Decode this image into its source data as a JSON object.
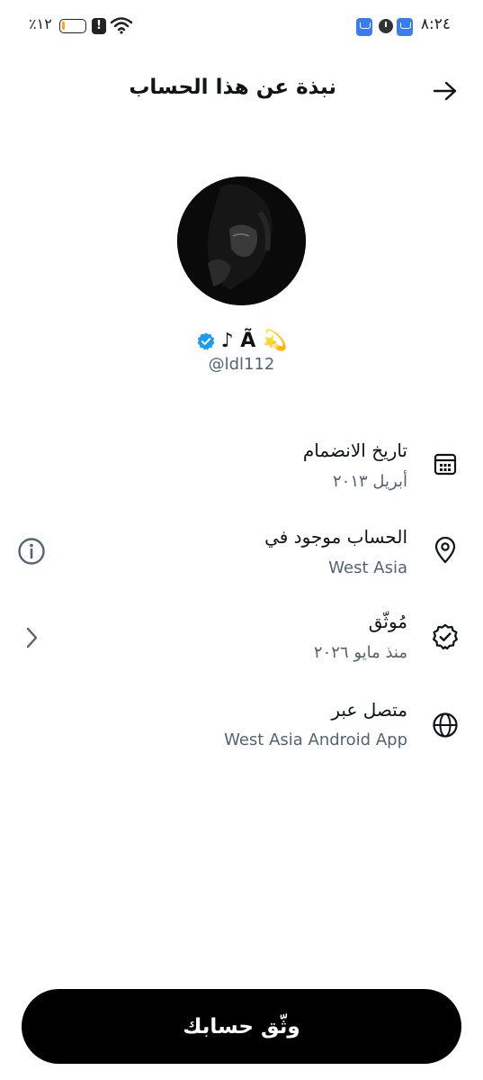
{
  "status_bar": {
    "time": "٨:٢٤",
    "battery": "٪١٢",
    "battery_level": 0.12,
    "icons": [
      "app-notification-icon",
      "alarm-clock-icon",
      "app-notification-icon",
      "alert-icon",
      "wifi-icon"
    ]
  },
  "header": {
    "title": "نبذة عن هذا الحساب",
    "back_icon": "arrow-right-icon"
  },
  "profile": {
    "display_name": "♪ Ã 💫",
    "verified": true,
    "handle": "@ldl112"
  },
  "info": {
    "joined": {
      "title": "تاريخ الانضمام",
      "value": "أبريل ٢٠١٣",
      "icon": "calendar-icon"
    },
    "location": {
      "title": "الحساب موجود في",
      "value": "West Asia",
      "icon": "location-pin-icon",
      "action_icon": "info-icon"
    },
    "verified": {
      "title": "مُوثّق",
      "value": "منذ مايو ٢٠٢٦",
      "icon": "verified-badge-icon",
      "action_icon": "chevron-left-icon"
    },
    "connected": {
      "title": "متصل عبر",
      "value": "West Asia Android App",
      "icon": "globe-icon"
    }
  },
  "verify_button": {
    "label": "وثّق حسابك"
  },
  "colors": {
    "text_primary": "#0f1419",
    "text_secondary": "#536471",
    "verified_blue": "#1d9bf0",
    "button_bg": "#000000",
    "battery_fill": "#f5a623"
  }
}
